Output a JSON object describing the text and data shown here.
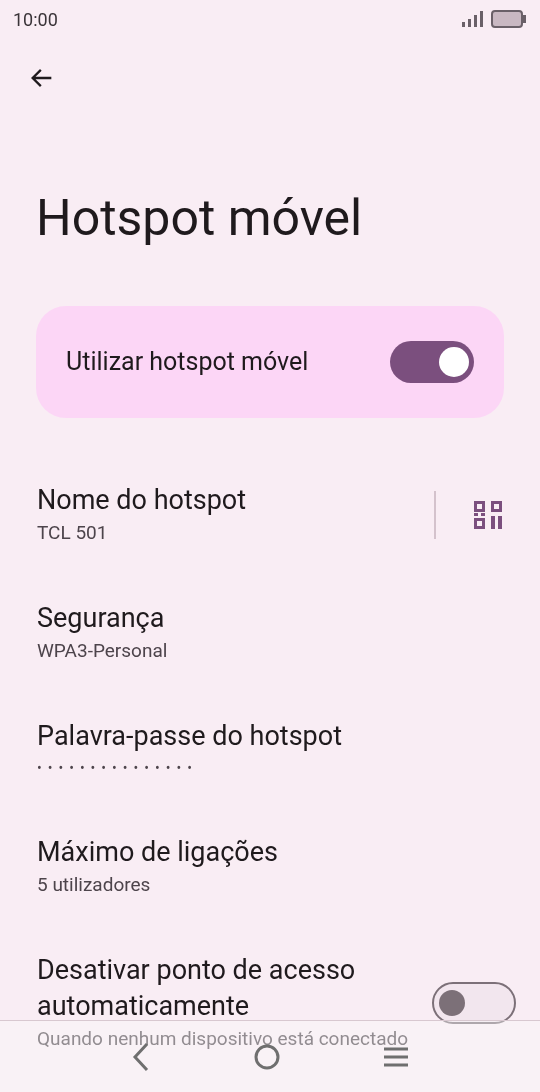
{
  "status_bar": {
    "time": "10:00"
  },
  "title": "Hotspot móvel",
  "main_switch": {
    "label": "Utilizar hotspot móvel",
    "on": true
  },
  "settings": [
    {
      "kind": "qr",
      "title": "Nome do hotspot",
      "subtitle": "TCL 501"
    },
    {
      "kind": "text",
      "title": "Segurança",
      "subtitle": "WPA3-Personal"
    },
    {
      "kind": "password",
      "title": "Palavra-passe do hotspot",
      "subtitle": "•••••••••••••••"
    },
    {
      "kind": "text",
      "title": "Máximo de ligações",
      "subtitle": "5 utilizadores"
    },
    {
      "kind": "switch",
      "title": "Desativar ponto de acesso automaticamente",
      "subtitle": "Quando nenhum dispositivo está conectado",
      "on": false
    }
  ]
}
